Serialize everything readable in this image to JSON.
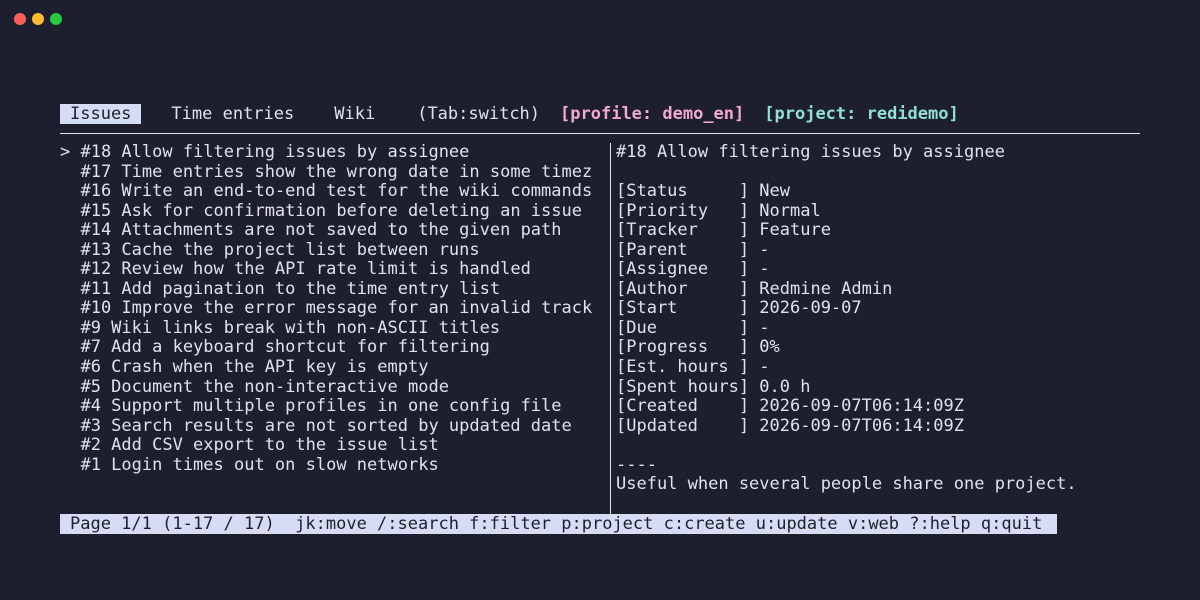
{
  "colors": {
    "background": "#1e1f2e",
    "foreground": "#dfe2ee",
    "active_tab_bg": "#d6dcf4",
    "profile": "#f2a9cf",
    "project": "#8fe0cf",
    "dot_red": "#ff5f57",
    "dot_yellow": "#febc2e",
    "dot_green": "#28c840"
  },
  "tabs": [
    {
      "label": "Issues",
      "active": true
    },
    {
      "label": "Time entries",
      "active": false
    },
    {
      "label": "Wiki",
      "active": false
    }
  ],
  "header": {
    "hint": "(Tab:switch)",
    "profile": "[profile: demo_en]",
    "project": "[project: redidemo]"
  },
  "issues": [
    {
      "text": "> #18 Allow filtering issues by assignee",
      "selected": true
    },
    {
      "text": "  #17 Time entries show the wrong date in some timez"
    },
    {
      "text": "  #16 Write an end-to-end test for the wiki commands"
    },
    {
      "text": "  #15 Ask for confirmation before deleting an issue"
    },
    {
      "text": "  #14 Attachments are not saved to the given path"
    },
    {
      "text": "  #13 Cache the project list between runs"
    },
    {
      "text": "  #12 Review how the API rate limit is handled"
    },
    {
      "text": "  #11 Add pagination to the time entry list"
    },
    {
      "text": "  #10 Improve the error message for an invalid track"
    },
    {
      "text": "  #9 Wiki links break with non-ASCII titles"
    },
    {
      "text": "  #7 Add a keyboard shortcut for filtering"
    },
    {
      "text": "  #6 Crash when the API key is empty"
    },
    {
      "text": "  #5 Document the non-interactive mode"
    },
    {
      "text": "  #4 Support multiple profiles in one config file"
    },
    {
      "text": "  #3 Search results are not sorted by updated date"
    },
    {
      "text": "  #2 Add CSV export to the issue list"
    },
    {
      "text": "  #1 Login times out on slow networks"
    }
  ],
  "detail": {
    "title": "#18 Allow filtering issues by assignee",
    "fields": [
      "[Status     ] New",
      "[Priority   ] Normal",
      "[Tracker    ] Feature",
      "[Parent     ] -",
      "[Assignee   ] -",
      "[Author     ] Redmine Admin",
      "[Start      ] 2026-09-07",
      "[Due        ] -",
      "[Progress   ] 0%",
      "[Est. hours ] -",
      "[Spent hours] 0.0 h",
      "[Created    ] 2026-09-07T06:14:09Z",
      "[Updated    ] 2026-09-07T06:14:09Z"
    ],
    "separator": "----",
    "description": "Useful when several people share one project."
  },
  "status_bar": "Page 1/1 (1-17 / 17)  jk:move /:search f:filter p:project c:create u:update v:web ?:help q:quit"
}
